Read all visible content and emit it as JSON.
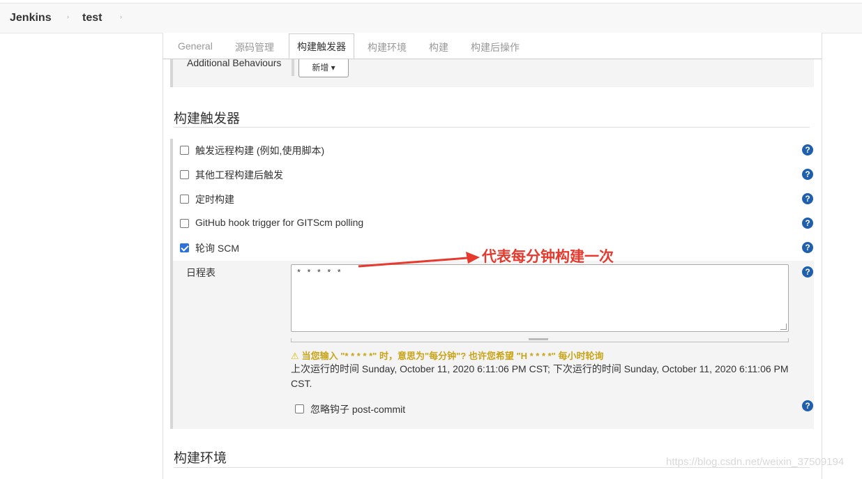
{
  "breadcrumb": {
    "root": "Jenkins",
    "job": "test",
    "separator": "›"
  },
  "tabs": [
    {
      "label": "General",
      "active": false
    },
    {
      "label": "源码管理",
      "active": false
    },
    {
      "label": "构建触发器",
      "active": true
    },
    {
      "label": "构建环境",
      "active": false
    },
    {
      "label": "构建",
      "active": false
    },
    {
      "label": "构建后操作",
      "active": false
    }
  ],
  "scm_section": {
    "additional_behaviours_label": "Additional Behaviours",
    "add_button_label": "新增 ▾"
  },
  "triggers": {
    "title": "构建触发器",
    "options": [
      {
        "label": "触发远程构建 (例如,使用脚本)",
        "checked": false
      },
      {
        "label": "其他工程构建后触发",
        "checked": false
      },
      {
        "label": "定时构建",
        "checked": false
      },
      {
        "label": "GitHub hook trigger for GITScm polling",
        "checked": false
      },
      {
        "label": "轮询 SCM",
        "checked": true
      }
    ],
    "poll_scm": {
      "schedule_label": "日程表",
      "schedule_value": "* * * * *",
      "warning": "当您输入 \"* * * * *\" 时，意思为\"每分钟\"? 也许您希望 \"H * * * *\" 每小时轮询",
      "run_info": "上次运行的时间 Sunday, October 11, 2020 6:11:06 PM CST; 下次运行的时间 Sunday, October 11, 2020 6:11:06 PM CST.",
      "ignore_hooks_label": "忽略钩子 post-commit",
      "ignore_hooks_checked": false
    }
  },
  "build_env": {
    "title": "构建环境"
  },
  "help_icon_glyph": "?",
  "annotation": {
    "text": "代表每分钟构建一次",
    "color": "#e53a2d"
  },
  "watermark": "https://blog.csdn.net/weixin_37509194",
  "colors": {
    "help_icon": "#1f5fad",
    "checkbox_checked": "#2b72d9",
    "warning": "#c9a419"
  }
}
